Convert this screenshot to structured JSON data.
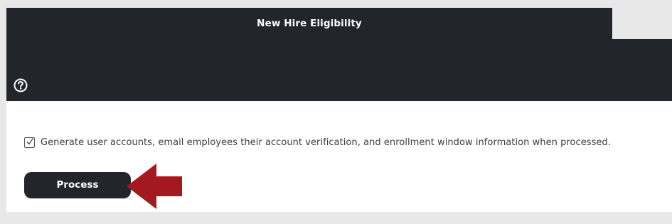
{
  "header": {
    "title": "New Hire Eligibility"
  },
  "help": {
    "icon": "help-icon"
  },
  "form": {
    "checkbox_checked": true,
    "checkbox_label": "Generate user accounts, email employees their account verification, and enrollment window information when processed.",
    "process_label": "Process"
  },
  "annotation": {
    "arrow_icon": "pointer-arrow-icon",
    "arrow_color": "#a3191f"
  },
  "colors": {
    "header_bg": "#22262c",
    "page_bg": "#e8e8e8",
    "content_bg": "#ffffff",
    "button_bg": "#22262c",
    "arrow": "#a3191f"
  }
}
